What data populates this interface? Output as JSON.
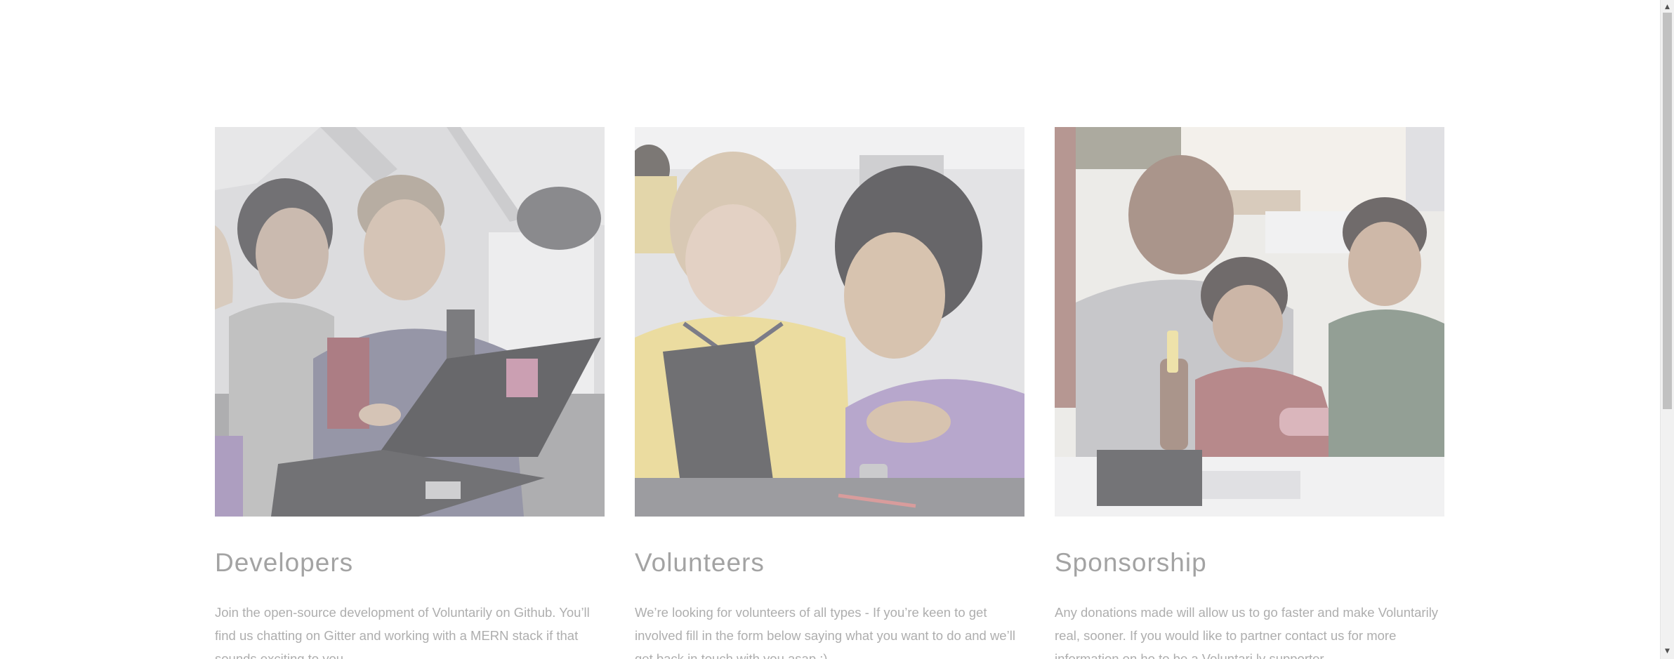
{
  "cards": [
    {
      "title": "Developers",
      "text": "Join the open-source development of Voluntarily on Github. You’ll find us chatting on Gitter and working with a MERN stack if that sounds exciting to you.",
      "image": "children-at-laptop-photo"
    },
    {
      "title": "Volunteers",
      "text": "We’re looking for volunteers of all types - If you’re keen to get involved fill in the form below saying what you want to do and we’ll get back in touch with you asap :)",
      "image": "girl-and-teacher-at-laptop-photo"
    },
    {
      "title": "Sponsorship",
      "text": "Any donations made will allow us to go faster and make Voluntarily real, sooner. If you would like to partner contact us for more information on ho to be a Voluntari.ly supporter.",
      "image": "man-and-boys-with-screwdriver-photo"
    }
  ],
  "scrollbar": {
    "up_icon": "triangle-up-icon",
    "down_icon": "triangle-down-icon",
    "up_glyph": "▲",
    "down_glyph": "▼"
  },
  "colors": {
    "title": "#808080",
    "text": "#8f8f8f",
    "background": "#ffffff"
  }
}
